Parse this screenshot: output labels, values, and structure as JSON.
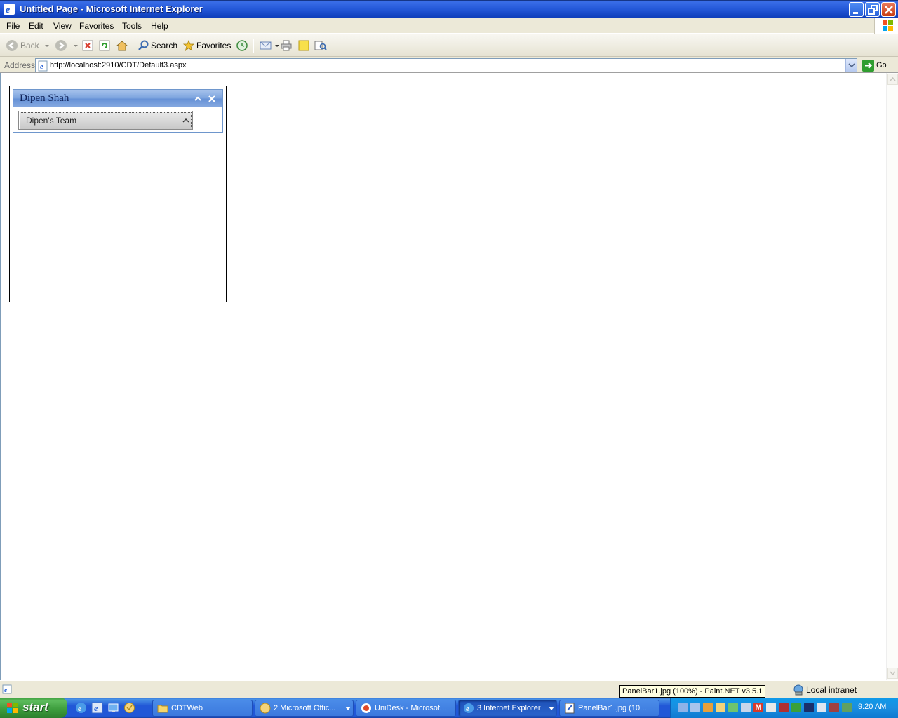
{
  "window": {
    "title": "Untitled Page - Microsoft Internet Explorer"
  },
  "menubar": {
    "items": [
      "File",
      "Edit",
      "View",
      "Favorites",
      "Tools",
      "Help"
    ]
  },
  "toolbar": {
    "back_label": "Back",
    "search_label": "Search",
    "favorites_label": "Favorites"
  },
  "address": {
    "label": "Address",
    "url": "http://localhost:2910/CDT/Default3.aspx",
    "go_label": "Go"
  },
  "panel": {
    "title": "Dipen Shah",
    "item_label": "Dipen's Team"
  },
  "status": {
    "tooltip": "PanelBar1.jpg (100%) - Paint.NET v3.5.1",
    "zone": "Local intranet"
  },
  "taskbar": {
    "start_label": "start",
    "tasks": [
      {
        "label": "CDTWeb"
      },
      {
        "label": "2 Microsoft Offic..."
      },
      {
        "label": "UniDesk - Microsof..."
      },
      {
        "label": "3 Internet Explorer"
      },
      {
        "label": "PanelBar1.jpg (10..."
      }
    ],
    "clock": "9:20 AM"
  },
  "colors": {
    "panel_header": "#7aa2de",
    "panel_title": "#10235a",
    "taskbar": "#2157d7",
    "start_button": "#3b9b3b"
  }
}
